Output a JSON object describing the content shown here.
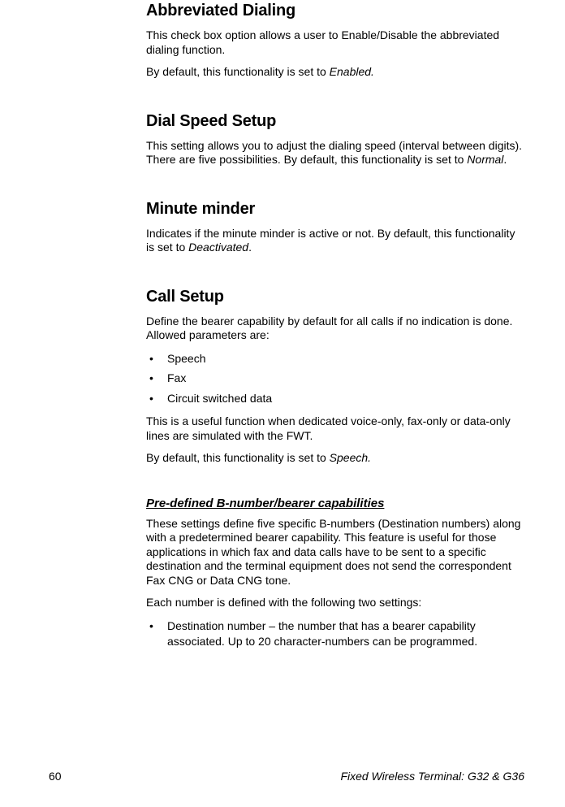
{
  "sections": {
    "abbrev": {
      "title": "Abbreviated Dialing",
      "p1": "This check box option allows a user to Enable/Disable the abbreviated dialing function.",
      "p2_a": "By default, this functionality is set to ",
      "p2_em": "Enabled."
    },
    "dialspeed": {
      "title": "Dial Speed Setup",
      "p1_a": "This setting allows you to adjust the dialing speed (interval between digits).  There are five possibilities. By default, this functionality is set to ",
      "p1_em": "Normal",
      "p1_b": "."
    },
    "minute": {
      "title": "Minute minder",
      "p1_a": "Indicates if the minute minder is active or not.  By default, this functionality is set to ",
      "p1_em": "Deactivated",
      "p1_b": "."
    },
    "callsetup": {
      "title": "Call Setup",
      "p1": "Define the bearer capability by default for all calls if no indication is done. Allowed parameters are:",
      "items": [
        "Speech",
        "Fax",
        "Circuit switched data"
      ],
      "p2": "This is a useful function when dedicated voice-only, fax-only or data-only lines are simulated with the FWT.",
      "p3_a": "By default, this functionality is set to ",
      "p3_em": "Speech."
    },
    "predef": {
      "title": "Pre-defined B-number/bearer capabilities",
      "p1": "These settings define five specific B-numbers (Destination numbers) along with a predetermined bearer capability. This feature is useful for those applications in which fax and data calls have to be sent to a specific destination and the terminal equipment does not send the correspondent Fax CNG or Data CNG tone.",
      "p2": "Each number is defined with the following two settings:",
      "items": [
        "Destination number – the number that has a bearer capability associated. Up to 20 character-numbers can be programmed."
      ]
    }
  },
  "footer": {
    "page": "60",
    "title": "Fixed Wireless Terminal: G32 & G36"
  }
}
